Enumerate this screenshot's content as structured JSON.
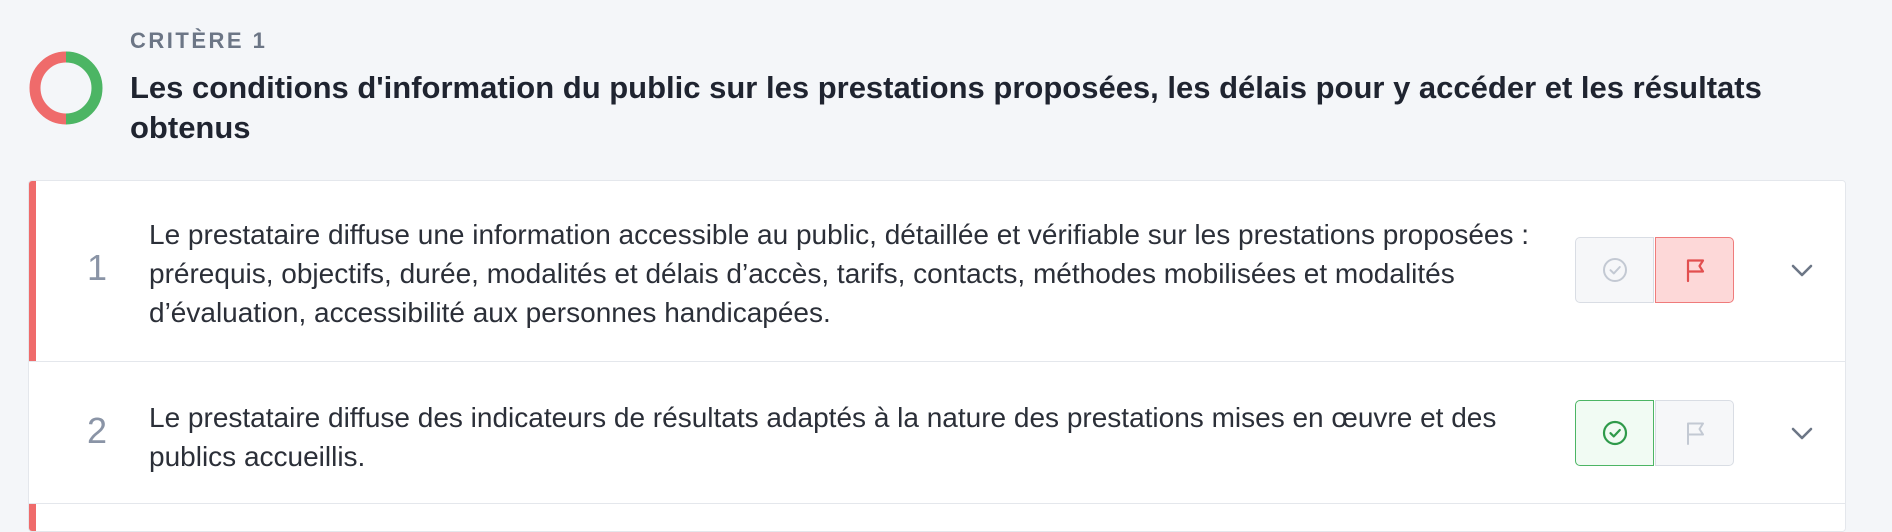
{
  "criterion": {
    "kicker": "CRITÈRE 1",
    "title": "Les conditions d'information du public sur les prestations proposées, les délais pour y accéder et les résultats obtenus",
    "progress_chart": {
      "type": "pie",
      "segments": [
        {
          "label": "conforme",
          "value": 50,
          "color": "#4cb564"
        },
        {
          "label": "non conforme",
          "value": 50,
          "color": "#ef6b6b"
        }
      ]
    }
  },
  "indicators": [
    {
      "number": "1",
      "text": "Le prestataire diffuse une information accessible au public, détaillée et vérifiable sur les prestations proposées : prérequis, objectifs, durée, modalités et délais d’accès, tarifs, contacts, méthodes mobilisées et modalités d’évaluation, accessibilité aux personnes handicapées.",
      "status": "non-conforme",
      "accent_color": "#ef6b6b"
    },
    {
      "number": "2",
      "text": "Le prestataire diffuse des indicateurs de résultats adaptés à la nature des prestations mises en œuvre et des publics accueillis.",
      "status": "conforme",
      "accent_color": ""
    },
    {
      "number": "",
      "text": "",
      "status": "non-conforme",
      "accent_color": "#ef6b6b"
    }
  ],
  "icons": {
    "validate": "check-circle-icon",
    "flag": "flag-icon",
    "expand": "chevron-down-icon"
  },
  "colors": {
    "danger": "#ef6b6b",
    "danger_bg": "#fdd8d8",
    "success": "#4cb564",
    "muted": "#c3c9d3"
  }
}
